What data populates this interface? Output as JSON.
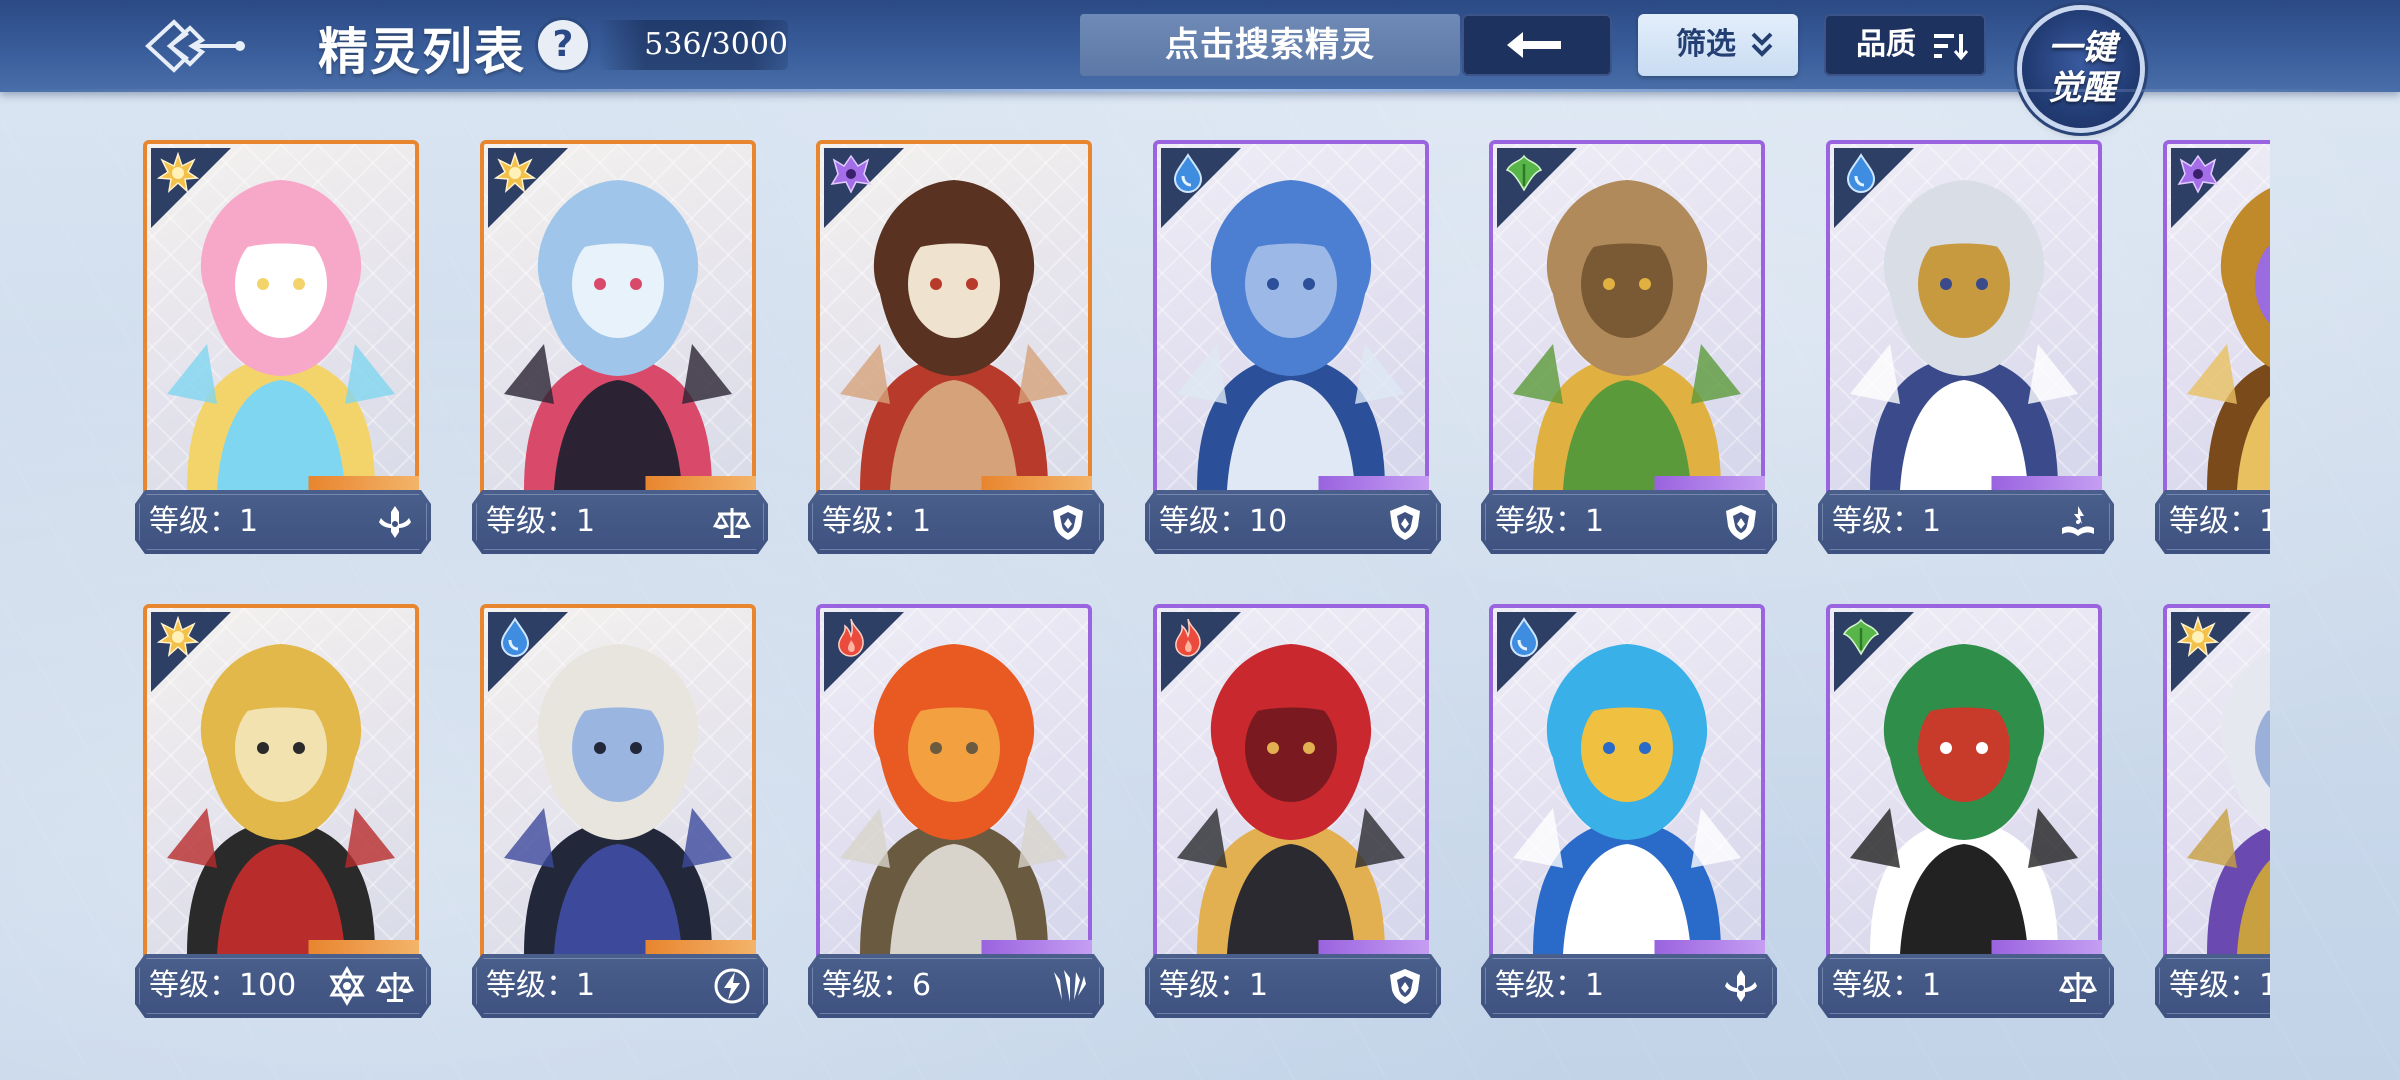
{
  "header": {
    "title": "精灵列表",
    "help_label": "?",
    "count": "536/3000",
    "search_placeholder": "点击搜索精灵",
    "filter_label": "筛选",
    "quality_label": "品质",
    "awaken_line1": "一键",
    "awaken_line2": "觉醒"
  },
  "colors": {
    "legendary": "#e8852f",
    "epic": "#9a63df",
    "header_blue": "#2b4a85",
    "corner_dark": "#2e3f66"
  },
  "spirits": [
    {
      "level": "等级：1",
      "rarity": "legendary",
      "element": "light",
      "roles": [
        "cross-emblem"
      ],
      "figure": "pink-crystal-fox"
    },
    {
      "level": "等级：1",
      "rarity": "legendary",
      "element": "light",
      "roles": [
        "scales"
      ],
      "figure": "silver-haired-demon-girl"
    },
    {
      "level": "等级：1",
      "rarity": "legendary",
      "element": "dark",
      "roles": [
        "shield"
      ],
      "figure": "brown-haired-boy"
    },
    {
      "level": "等级：10",
      "rarity": "epic",
      "element": "water",
      "roles": [
        "shield"
      ],
      "figure": "blue-armored-knight"
    },
    {
      "level": "等级：1",
      "rarity": "epic",
      "element": "grass",
      "roles": [
        "shield"
      ],
      "figure": "stone-golem"
    },
    {
      "level": "等级：1",
      "rarity": "epic",
      "element": "water",
      "roles": [
        "book"
      ],
      "figure": "fox-eared-mage"
    },
    {
      "level": "等级：1",
      "rarity": "epic",
      "element": "dark",
      "roles": [],
      "figure": "golden-beast"
    },
    {
      "level": "等级：100",
      "rarity": "legendary",
      "element": "light",
      "roles": [
        "scales",
        "hexagram"
      ],
      "figure": "golden-king"
    },
    {
      "level": "等级：1",
      "rarity": "legendary",
      "element": "water",
      "roles": [
        "lightning"
      ],
      "figure": "white-haired-elf"
    },
    {
      "level": "等级：6",
      "rarity": "epic",
      "element": "fire",
      "roles": [
        "claw"
      ],
      "figure": "flame-armor-warrior"
    },
    {
      "level": "等级：1",
      "rarity": "epic",
      "element": "fire",
      "roles": [
        "shield"
      ],
      "figure": "red-winged-swordsman"
    },
    {
      "level": "等级：1",
      "rarity": "epic",
      "element": "water",
      "roles": [
        "cross-emblem"
      ],
      "figure": "cyan-winged-archer"
    },
    {
      "level": "等级：1",
      "rarity": "epic",
      "element": "grass",
      "roles": [
        "scales"
      ],
      "figure": "bamboo-panda"
    },
    {
      "level": "等级：1",
      "rarity": "epic",
      "element": "light",
      "roles": [],
      "figure": "white-armored-paladin"
    }
  ]
}
